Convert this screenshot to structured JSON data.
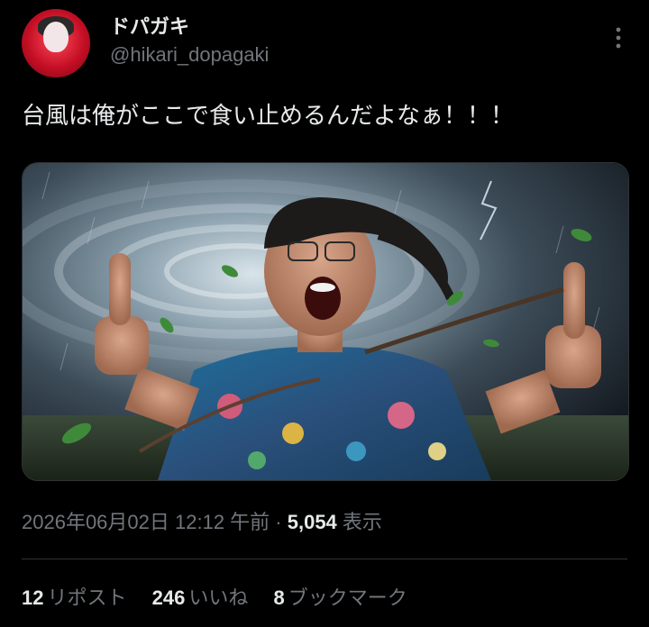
{
  "tweet": {
    "author": {
      "display_name": "ドパガキ",
      "handle": "@hikari_dopagaki",
      "avatar_icon": "avatar-icon"
    },
    "more_icon": "more-options-icon",
    "text": "台風は俺がここで食い止めるんだよなぁ！！！",
    "media": {
      "type": "photo"
    },
    "meta": {
      "timestamp": "2026年06月02日 12:12 午前",
      "separator": " · ",
      "views_count": "5,054",
      "views_label": "表示"
    },
    "stats": {
      "reposts_count": "12",
      "reposts_label": "リポスト",
      "likes_count": "246",
      "likes_label": "いいね",
      "bookmarks_count": "8",
      "bookmarks_label": "ブックマーク"
    }
  },
  "colors": {
    "background": "#000000",
    "text_primary": "#e7e9ea",
    "text_secondary": "#71767b",
    "divider": "#2f3336",
    "avatar_red": "#c40f25"
  }
}
